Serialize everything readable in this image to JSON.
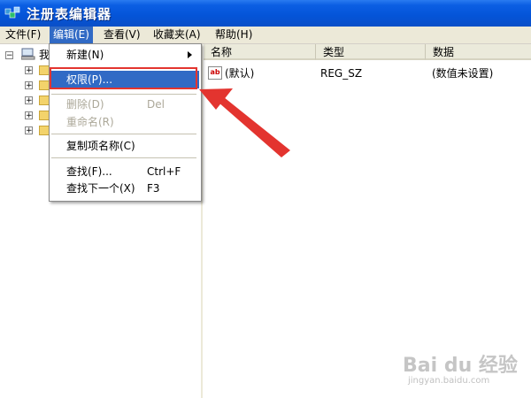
{
  "window": {
    "title": "注册表编辑器",
    "icon": "regedit-icon"
  },
  "menubar": {
    "items": [
      {
        "label": "文件(F)"
      },
      {
        "label": "编辑(E)"
      },
      {
        "label": "查看(V)"
      },
      {
        "label": "收藏夹(A)"
      },
      {
        "label": "帮助(H)"
      }
    ]
  },
  "edit_menu": {
    "items": [
      {
        "label": "新建(N)",
        "shortcut": ""
      },
      {
        "label": "权限(P)...",
        "shortcut": ""
      },
      {
        "label": "删除(D)",
        "shortcut": "Del"
      },
      {
        "label": "重命名(R)",
        "shortcut": ""
      },
      {
        "label": "复制项名称(C)",
        "shortcut": ""
      },
      {
        "label": "查找(F)...",
        "shortcut": "Ctrl+F"
      },
      {
        "label": "查找下一个(X)",
        "shortcut": "F3"
      }
    ]
  },
  "tree": {
    "root_label": "我"
  },
  "list": {
    "columns": [
      "名称",
      "类型",
      "数据"
    ],
    "rows": [
      {
        "name": "(默认)",
        "type": "REG_SZ",
        "data": "(数值未设置)"
      }
    ]
  },
  "watermark": {
    "main": "Bai du 经验",
    "sub": "jingyan.baidu.com"
  },
  "colors": {
    "highlight": "#316ac5",
    "annotation": "#e3342f",
    "titlebar": "#0454d8"
  }
}
